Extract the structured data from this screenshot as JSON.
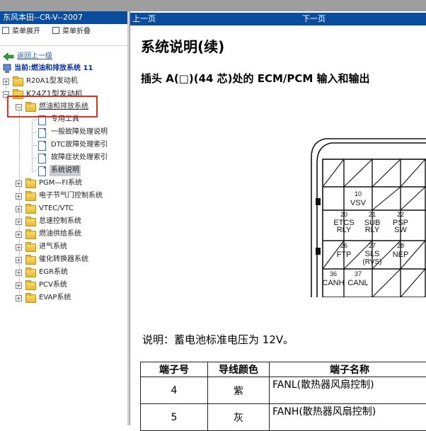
{
  "app": {
    "title": "东风本田--CR-V--2007"
  },
  "menu": {
    "expand_label": "菜单展开",
    "collapse_label": "菜单折叠"
  },
  "nav": {
    "back_label": "返回上一级",
    "current_location": "当前:燃油和排放系统 11"
  },
  "tree": {
    "r20": "R20A1型发动机",
    "k24": "K24Z1型发动机",
    "fuel_emission": "燃油和排放系统",
    "children": [
      "专用工具",
      "一般故障处理说明",
      "DTC故障处理索引",
      "故障症状处理索引",
      "系统说明"
    ],
    "systems": [
      "PGM—FI系统",
      "电子节气门控制系统",
      "VTEC/VTC",
      "怠速控制系统",
      "燃油供给系统",
      "进气系统",
      "催化转换器系统",
      "EGR系统",
      "PCV系统",
      "EVAP系统"
    ]
  },
  "doc_nav": {
    "prev": "上一页",
    "next": "下一页"
  },
  "doc": {
    "title": "系统说明(续)",
    "subtitle": "插头 A(□)(44 芯)处的 ECM/PCM 输入和输出",
    "note": "说明：蓄电池标准电压为 12V。"
  },
  "connector": {
    "pins": [
      {
        "num": "10",
        "name": "VSV"
      },
      {
        "num": "20",
        "name": "ETCS RLY"
      },
      {
        "num": "21",
        "name": "SUB RLY"
      },
      {
        "num": "22",
        "name": "PSP SW"
      },
      {
        "num": "26",
        "name": "FTP"
      },
      {
        "num": "27",
        "name": "SLS (RVS)"
      },
      {
        "num": "28",
        "name": "NEP"
      },
      {
        "num": "36",
        "name": "CANH"
      },
      {
        "num": "37",
        "name": "CANL"
      }
    ]
  },
  "table": {
    "headers": [
      "端子号",
      "导线颜色",
      "端子名称"
    ],
    "rows": [
      {
        "num": "4",
        "color": "紫",
        "name": "FANL(散热器风扇控制)"
      },
      {
        "num": "5",
        "color": "灰",
        "name": "FANH(散热器风扇控制)"
      }
    ]
  }
}
